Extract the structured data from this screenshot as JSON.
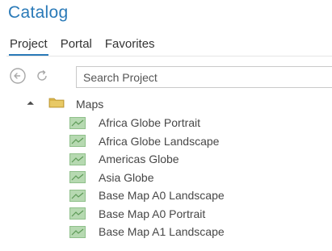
{
  "panel": {
    "title": "Catalog"
  },
  "tabs": [
    {
      "label": "Project",
      "active": true
    },
    {
      "label": "Portal",
      "active": false
    },
    {
      "label": "Favorites",
      "active": false
    }
  ],
  "toolbar": {
    "back_icon": "back-arrow-icon",
    "refresh_icon": "refresh-icon"
  },
  "search": {
    "placeholder": "Search Project",
    "value": ""
  },
  "tree": {
    "folder": {
      "label": "Maps",
      "expanded": true,
      "icon": "folder-icon"
    },
    "items": [
      {
        "label": "Africa Globe Portrait",
        "icon": "map-icon"
      },
      {
        "label": "Africa Globe Landscape",
        "icon": "map-icon"
      },
      {
        "label": "Americas Globe",
        "icon": "map-icon"
      },
      {
        "label": "Asia Globe",
        "icon": "map-icon"
      },
      {
        "label": "Base Map A0 Landscape",
        "icon": "map-icon"
      },
      {
        "label": "Base Map A0 Portrait",
        "icon": "map-icon"
      },
      {
        "label": "Base Map A1 Landscape",
        "icon": "map-icon"
      }
    ]
  },
  "colors": {
    "accent": "#2a7ab8",
    "folder": "#d9b44a",
    "map_icon": "#8fc08a"
  }
}
